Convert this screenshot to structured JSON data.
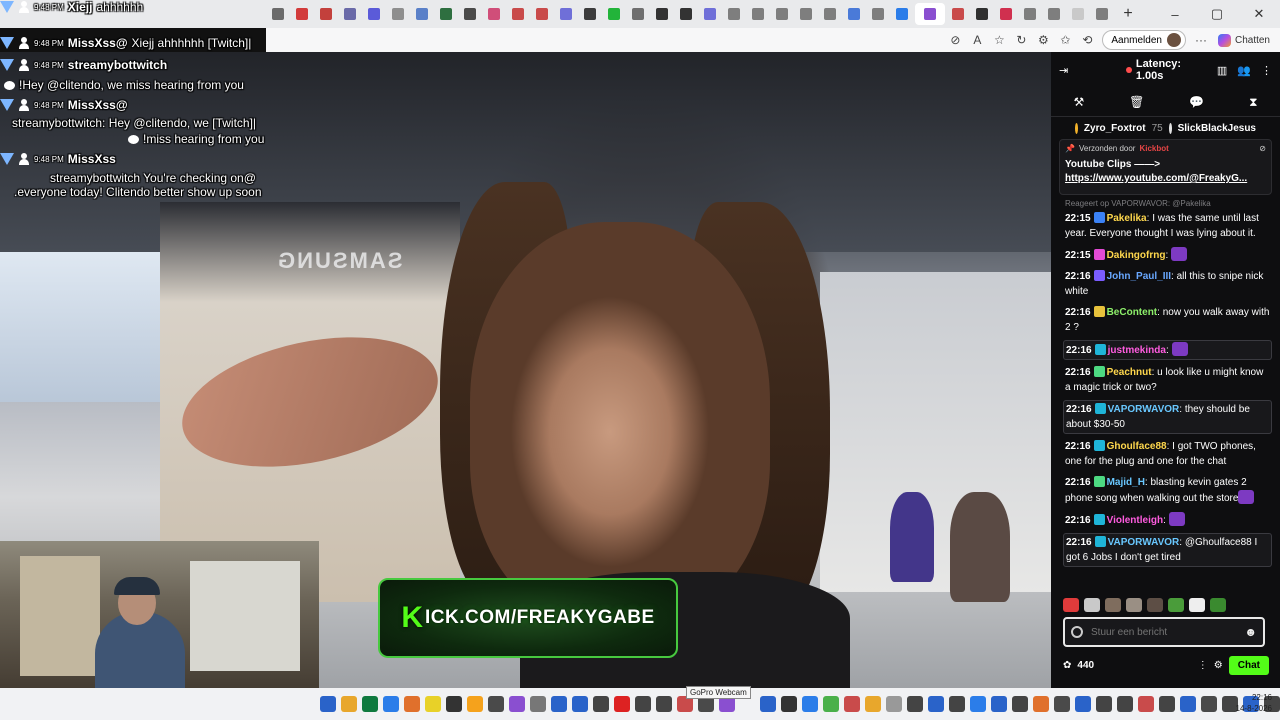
{
  "browser": {
    "signin_label": "Aanmelden",
    "copilot_label": "Chatten",
    "new_tab": "+",
    "tabs": [
      {
        "favicon": "#6b6b6b"
      },
      {
        "favicon": "#d23b3b"
      },
      {
        "favicon": "#c3403c"
      },
      {
        "favicon": "#6a6aa8"
      },
      {
        "favicon": "#5b5bd9"
      },
      {
        "favicon": "#8e8e8e"
      },
      {
        "favicon": "#5a80c8"
      },
      {
        "favicon": "#2e6f40"
      },
      {
        "favicon": "#4a4a4a"
      },
      {
        "favicon": "#d04e79"
      },
      {
        "favicon": "#c94b4b"
      },
      {
        "favicon": "#c94b4b"
      },
      {
        "favicon": "#6f6fd8"
      },
      {
        "favicon": "#3c3c3c"
      },
      {
        "favicon": "#22b43a"
      },
      {
        "favicon": "#6f6f6f"
      },
      {
        "favicon": "#333333"
      },
      {
        "favicon": "#333333"
      },
      {
        "favicon": "#6f6fd8"
      },
      {
        "favicon": "#7e7e7e"
      },
      {
        "favicon": "#7e7e7e"
      },
      {
        "favicon": "#7e7e7e"
      },
      {
        "favicon": "#7e7e7e"
      },
      {
        "favicon": "#7e7e7e"
      },
      {
        "favicon": "#4a7ad8"
      },
      {
        "favicon": "#7e7e7e"
      },
      {
        "favicon": "#2b7de9"
      },
      {
        "favicon": "#8a4fd0"
      },
      {
        "favicon": "#c94b4b"
      },
      {
        "favicon": "#303030"
      },
      {
        "favicon": "#d0304f"
      },
      {
        "favicon": "#7e7e7e"
      },
      {
        "favicon": "#7e7e7e"
      },
      {
        "favicon": "#c9c9c9"
      },
      {
        "favicon": "#7e7e7e"
      }
    ]
  },
  "overlay_chat": [
    {
      "time": "9:48 PM",
      "user": "Xiejj",
      "message": "ahhhhhh"
    },
    {
      "time": "9:48 PM",
      "user": "MissXss@",
      "message": "Xiejj ahhhhhh [Twitch]|"
    },
    {
      "time": "9:48 PM",
      "user": "streamybottwitch",
      "message": "!Hey @clitendo, we miss hearing from you"
    },
    {
      "time": "9:48 PM",
      "user": "MissXss@",
      "message": "streamybottwitch: Hey @clitendo, we [Twitch]|",
      "message2": "!miss hearing from you"
    },
    {
      "time": "9:48 PM",
      "user": "MissXss",
      "message": "streamybottwitch You're checking on@",
      "message2": ".everyone today! Clitendo better show up soon"
    }
  ],
  "stream": {
    "banner": "ICK.COM/FREAKYGABE",
    "banner_k": "K",
    "sign_text": "SAMSUNG"
  },
  "chatpanel": {
    "latency": "Latency: 1.00s",
    "gifters": [
      {
        "name": "Zyro_Foxtrot",
        "score": "75"
      },
      {
        "name": "SlickBlackJesus",
        "score": ""
      }
    ],
    "pinned": {
      "header": "Verzonden door",
      "by": "Kickbot",
      "title": "Youtube Clips ——>",
      "link": "https://www.youtube.com/@FreakyG..."
    },
    "reply_hint": "Reageert op VAPORWAVOR: @Pakelika",
    "messages": [
      {
        "time": "22:15",
        "user": "Pakelika",
        "color": "#ffd84d",
        "text": "I was the same until last year. Everyone thought I was lying about it.",
        "hl": false,
        "badge": "#3b82f6"
      },
      {
        "time": "22:15",
        "user": "Dakingofrng",
        "color": "#ffd84d",
        "text": "",
        "hl": false,
        "badge": "#e44bd6",
        "emote": true
      },
      {
        "time": "22:16",
        "user": "John_Paul_III",
        "color": "#69a8ff",
        "text": "all this to snipe nick white",
        "hl": false,
        "badge": "#7a5cff"
      },
      {
        "time": "22:16",
        "user": "BeContent",
        "color": "#8ef06b",
        "text": "now you walk away with 2 ?",
        "hl": false,
        "badge": "#e8c23c"
      },
      {
        "time": "22:16",
        "user": "justmekinda",
        "color": "#ff5ce0",
        "text": "",
        "hl": true,
        "badge": "#1fb5d8",
        "emote": true
      },
      {
        "time": "22:16",
        "user": "Peachnut",
        "color": "#ffd84d",
        "text": "u look like u might know a magic trick or two?",
        "hl": false,
        "badge": "#4dd982"
      },
      {
        "time": "22:16",
        "user": "VAPORWAVOR",
        "color": "#69c8ff",
        "text": "they should be about $30-50",
        "hl": true,
        "badge": "#1fb5d8"
      },
      {
        "time": "22:16",
        "user": "Ghoulface88",
        "color": "#ffd84d",
        "text": "I got TWO phones, one for the plug and one for the chat",
        "hl": false,
        "badge": "#1fb5d8"
      },
      {
        "time": "22:16",
        "user": "Majid_H",
        "color": "#69c8ff",
        "text": "blasting kevin gates 2 phone song when walking out the store",
        "hl": false,
        "badge": "#4dd982",
        "emote": true
      },
      {
        "time": "22:16",
        "user": "Violentleigh",
        "color": "#ff5ce0",
        "text": "",
        "hl": false,
        "badge": "#1fb5d8",
        "emote": true
      },
      {
        "time": "22:16",
        "user": "VAPORWAVOR",
        "color": "#69c8ff",
        "text": "@Ghoulface88 I got 6 Jobs I don't get tired",
        "hl": true,
        "badge": "#1fb5d8"
      }
    ],
    "input_placeholder": "Stuur een bericht",
    "points": "440",
    "chat_button": "Chat",
    "emote_colors": [
      "#e03b3b",
      "#c9c9c9",
      "#7f6d5e",
      "#9a8f84",
      "#5d4e45",
      "#4a9c3a",
      "#eeeeee",
      "#3a8a2f"
    ]
  },
  "taskbar": {
    "tooltip": "GoPro Webcam",
    "time": "22:16",
    "date": "14-8-2026",
    "icons": [
      "#2a63c9",
      "#e8a72c",
      "#0f7a3f",
      "#2b7de9",
      "#e0702c",
      "#e8d128",
      "#333",
      "#f5a21c",
      "#4a4a4a",
      "#8a4fd0",
      "#777",
      "#2a63c9",
      "#2a63c9",
      "#444",
      "#d22",
      "#444",
      "#444",
      "#c94b4b",
      "#4a4a4a",
      "#8a4fd0"
    ],
    "tray": [
      "#2a63c9",
      "#333",
      "#2b7de9",
      "#4ab04a",
      "#c94b4b",
      "#e8a72c",
      "#999",
      "#444",
      "#2a63c9",
      "#444",
      "#2b7de9",
      "#2a63c9",
      "#444",
      "#e0702c",
      "#4a4a4a",
      "#2a63c9",
      "#444",
      "#444",
      "#c94b4b",
      "#444",
      "#2a63c9",
      "#4a4a4a",
      "#444",
      "#2a63c9",
      "#444",
      "#2a63c9",
      "#444",
      "#444",
      "#444"
    ]
  }
}
